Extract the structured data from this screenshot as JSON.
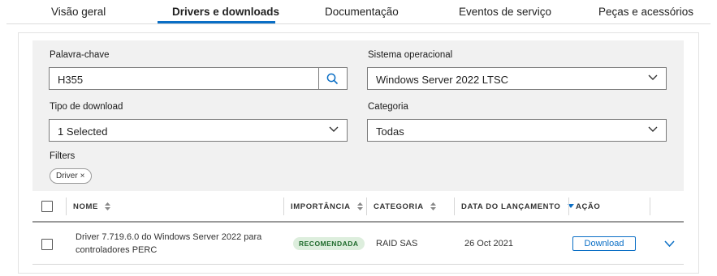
{
  "tabs": [
    {
      "label": "Visão geral"
    },
    {
      "label": "Drivers e downloads"
    },
    {
      "label": "Documentação"
    },
    {
      "label": "Eventos de serviço"
    },
    {
      "label": "Peças e acessórios"
    }
  ],
  "active_tab_index": 1,
  "colors": {
    "accent": "#0a6ec5",
    "badge_bg": "#ddeedd",
    "badge_text": "#1e6a2b"
  },
  "filters": {
    "keyword": {
      "label": "Palavra-chave",
      "value": "H355",
      "icon": "search-icon"
    },
    "os": {
      "label": "Sistema operacional",
      "value": "Windows Server 2022 LTSC"
    },
    "download_type": {
      "label": "Tipo de download",
      "value": "1 Selected"
    },
    "category": {
      "label": "Categoria",
      "value": "Todas"
    },
    "filters_label": "Filters",
    "chips": [
      {
        "label": "Driver",
        "remove": "×"
      }
    ]
  },
  "table": {
    "headers": {
      "name": "NOME",
      "importance": "IMPORTÂNCIA",
      "category": "CATEGORIA",
      "release_date": "DATA DO LANÇAMENTO",
      "action": "AÇÃO"
    },
    "rows": [
      {
        "name_line1": "Driver 7.719.6.0 do Windows Server 2022 para",
        "name_line2": "controladores PERC",
        "importance": "RECOMENDADA",
        "category": "RAID SAS",
        "release_date": "26 Oct 2021",
        "action": "Download"
      }
    ]
  }
}
